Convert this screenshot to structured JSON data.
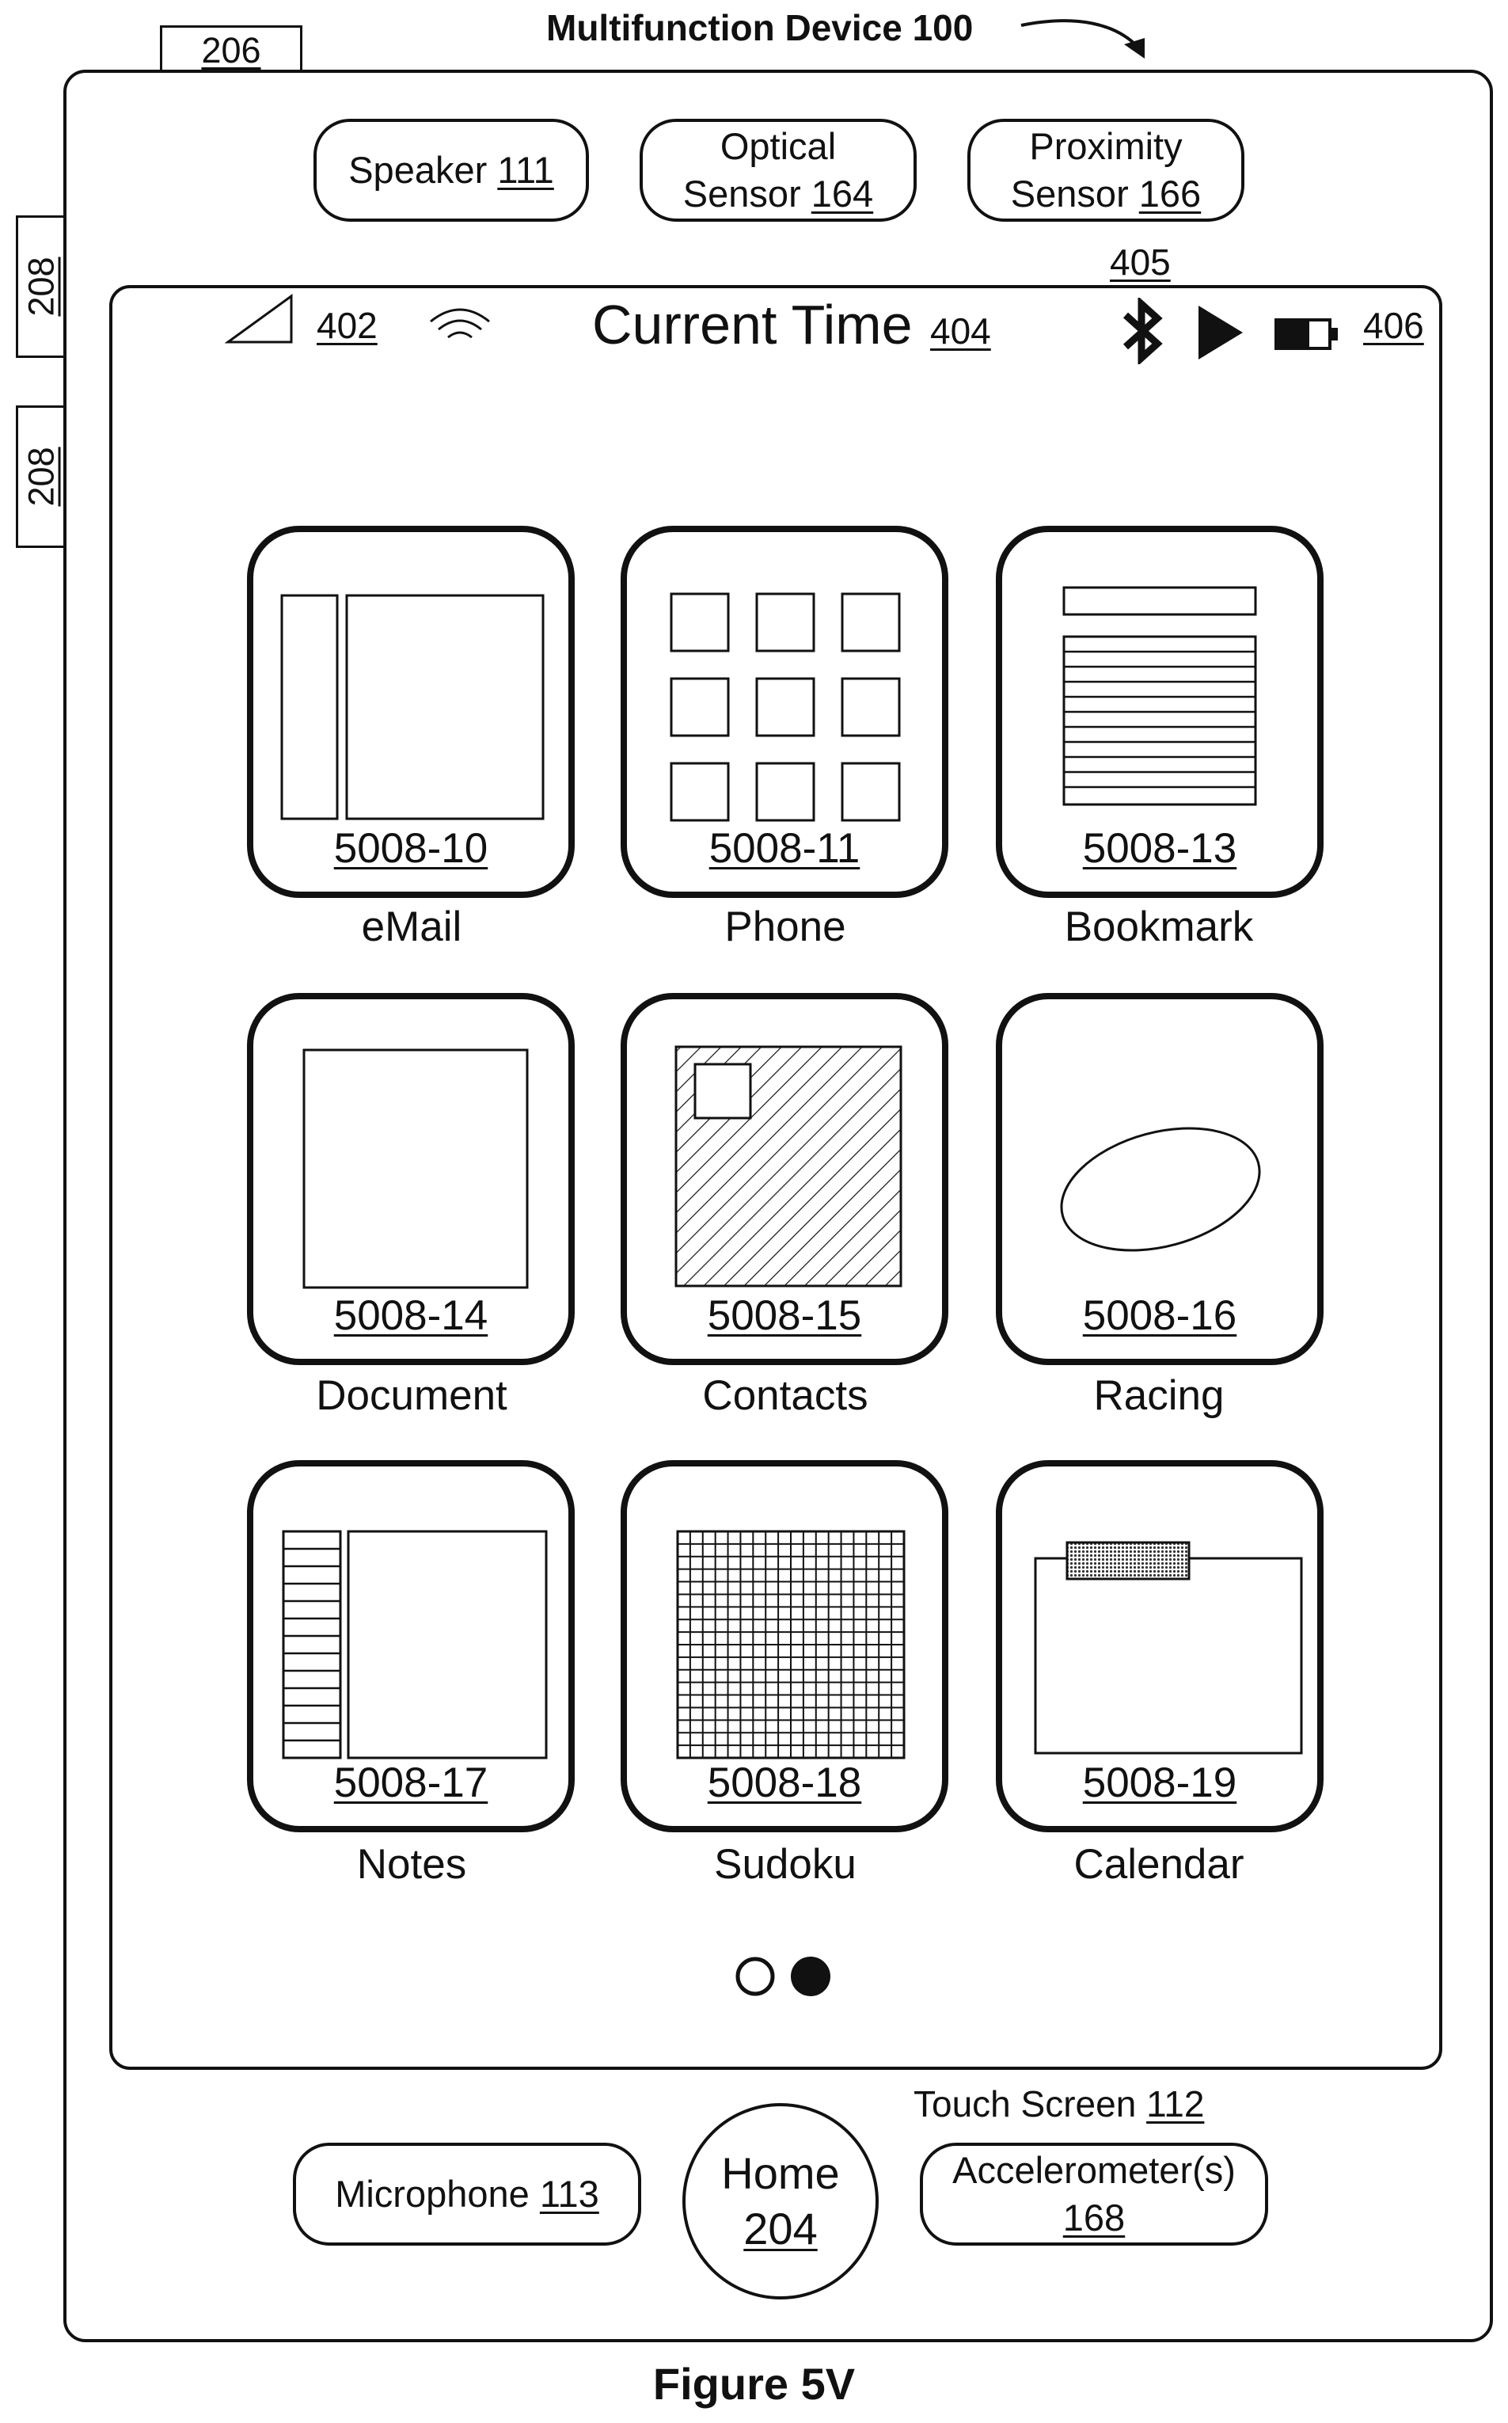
{
  "device": {
    "title_text": "Multifunction Device",
    "title_ref": "100",
    "tab_top": "206",
    "tab_side_1": "208",
    "tab_side_2": "208"
  },
  "sensors": {
    "speaker": {
      "label": "Speaker",
      "ref": "111"
    },
    "optical": {
      "line1": "Optical",
      "line2": "Sensor",
      "ref": "164"
    },
    "proximity": {
      "line1": "Proximity",
      "line2": "Sensor",
      "ref": "166"
    }
  },
  "status_bar": {
    "signal_ref": "402",
    "current_time": "Current Time",
    "time_ref": "404",
    "icons_ref": "405",
    "battery_ref": "406"
  },
  "apps": [
    {
      "ref": "5008-10",
      "label": "eMail",
      "icon": "email-icon"
    },
    {
      "ref": "5008-11",
      "label": "Phone",
      "icon": "phone-keypad-icon"
    },
    {
      "ref": "5008-13",
      "label": "Bookmark",
      "icon": "bookmark-icon"
    },
    {
      "ref": "5008-14",
      "label": "Document",
      "icon": "document-icon"
    },
    {
      "ref": "5008-15",
      "label": "Contacts",
      "icon": "contacts-icon"
    },
    {
      "ref": "5008-16",
      "label": "Racing",
      "icon": "racing-icon"
    },
    {
      "ref": "5008-17",
      "label": "Notes",
      "icon": "notes-icon"
    },
    {
      "ref": "5008-18",
      "label": "Sudoku",
      "icon": "sudoku-grid-icon"
    },
    {
      "ref": "5008-19",
      "label": "Calendar",
      "icon": "calendar-icon"
    }
  ],
  "touch_screen": {
    "label": "Touch Screen",
    "ref": "112"
  },
  "bottom": {
    "microphone": {
      "label": "Microphone",
      "ref": "113"
    },
    "home": {
      "label": "Home",
      "ref": "204"
    },
    "accelerometer": {
      "label": "Accelerometer(s)",
      "ref": "168"
    }
  },
  "caption": "Figure 5V"
}
